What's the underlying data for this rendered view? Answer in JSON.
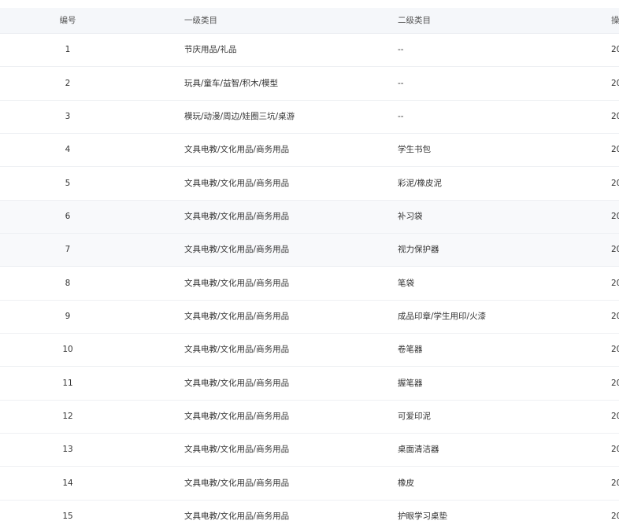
{
  "table": {
    "headers": {
      "id": "编号",
      "level1": "一级类目",
      "level2": "二级类目",
      "extra": "操"
    },
    "rows": [
      {
        "id": "1",
        "level1": "节庆用品/礼品",
        "level2": "--",
        "extra": "20"
      },
      {
        "id": "2",
        "level1": "玩具/童车/益智/积木/模型",
        "level2": "--",
        "extra": "20"
      },
      {
        "id": "3",
        "level1": "模玩/动漫/周边/娃圈三坑/桌游",
        "level2": "--",
        "extra": "20"
      },
      {
        "id": "4",
        "level1": "文具电教/文化用品/商务用品",
        "level2": "学生书包",
        "extra": "20"
      },
      {
        "id": "5",
        "level1": "文具电教/文化用品/商务用品",
        "level2": "彩泥/橡皮泥",
        "extra": "20"
      },
      {
        "id": "6",
        "level1": "文具电教/文化用品/商务用品",
        "level2": "补习袋",
        "extra": "20"
      },
      {
        "id": "7",
        "level1": "文具电教/文化用品/商务用品",
        "level2": "视力保护器",
        "extra": "20"
      },
      {
        "id": "8",
        "level1": "文具电教/文化用品/商务用品",
        "level2": "笔袋",
        "extra": "20"
      },
      {
        "id": "9",
        "level1": "文具电教/文化用品/商务用品",
        "level2": "成品印章/学生用印/火漆",
        "extra": "20"
      },
      {
        "id": "10",
        "level1": "文具电教/文化用品/商务用品",
        "level2": "卷笔器",
        "extra": "20"
      },
      {
        "id": "11",
        "level1": "文具电教/文化用品/商务用品",
        "level2": "握笔器",
        "extra": "20"
      },
      {
        "id": "12",
        "level1": "文具电教/文化用品/商务用品",
        "level2": "可爱印泥",
        "extra": "20"
      },
      {
        "id": "13",
        "level1": "文具电教/文化用品/商务用品",
        "level2": "桌面清洁器",
        "extra": "20"
      },
      {
        "id": "14",
        "level1": "文具电教/文化用品/商务用品",
        "level2": "橡皮",
        "extra": "20"
      },
      {
        "id": "15",
        "level1": "文具电教/文化用品/商务用品",
        "level2": "护眼学习桌垫",
        "extra": "20"
      }
    ]
  }
}
